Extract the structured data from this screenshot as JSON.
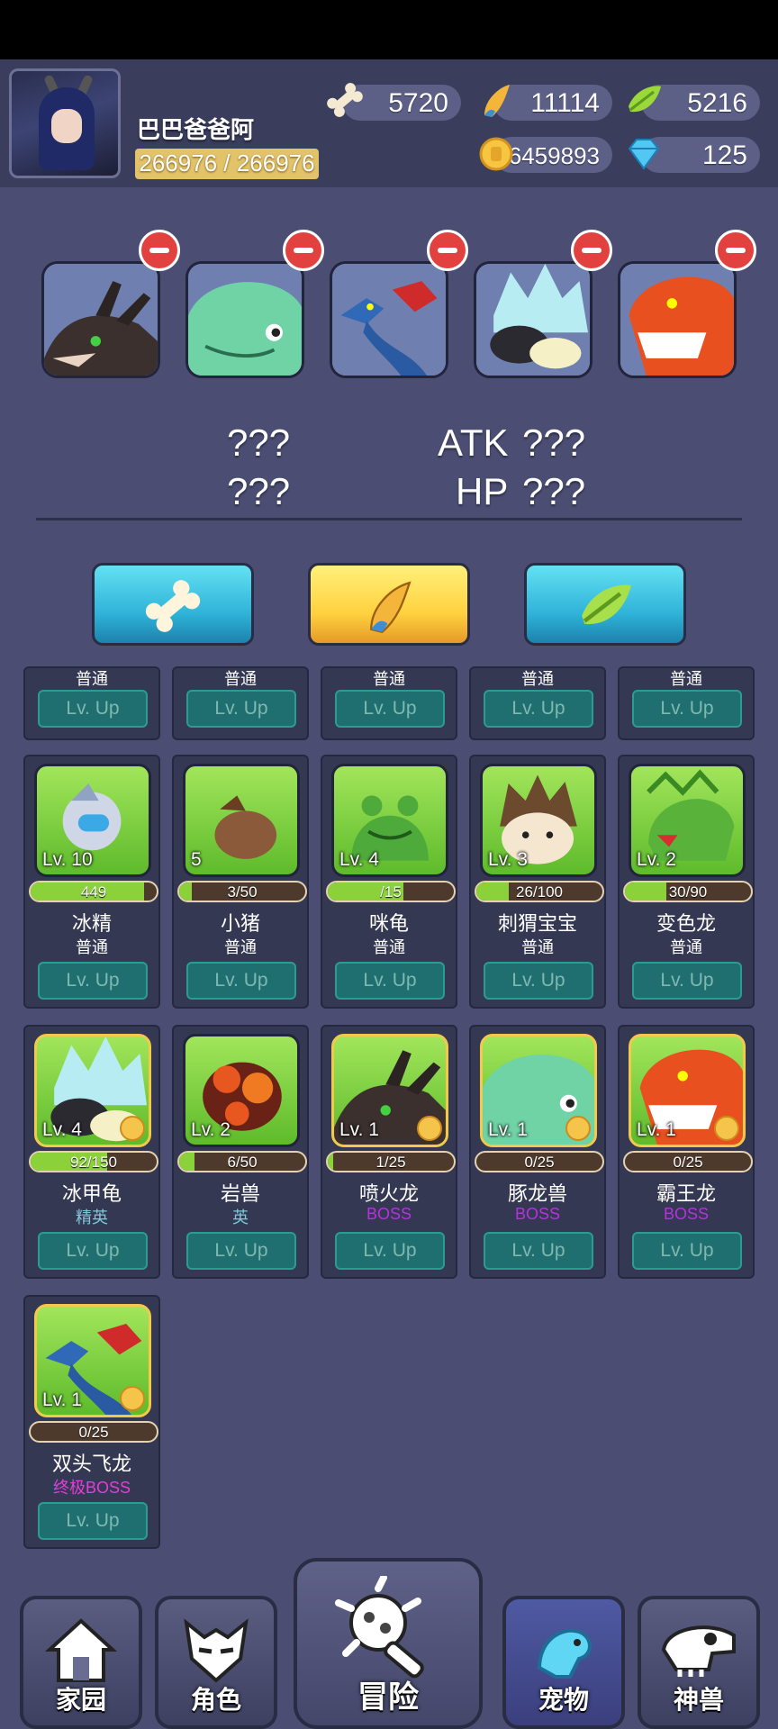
{
  "player": {
    "name": "巴巴爸爸阿",
    "hp_text": "266976 / 266976"
  },
  "resources": {
    "bone": "5720",
    "horn": "11114",
    "leaf": "5216",
    "coin": "6459893",
    "gem": "125"
  },
  "team_stats": {
    "left_top": "???",
    "left_bottom": "???",
    "atk_label": "ATK",
    "atk_value": "???",
    "hp_label": "HP",
    "hp_value": "???"
  },
  "partial_row": {
    "rarity": "普通",
    "button": "Lv. Up"
  },
  "pets": [
    {
      "name": "冰精",
      "level": "Lv. 10",
      "exp": "449",
      "exp_fill": 0.9,
      "rarity": "普通",
      "rarity_color": "#ffffff",
      "button": "Lv. Up"
    },
    {
      "name": "小猪",
      "level": "5",
      "exp": "3/50",
      "exp_fill": 0.1,
      "rarity": "普通",
      "rarity_color": "#ffffff",
      "button": "Lv. Up"
    },
    {
      "name": "咪龟",
      "level": "Lv. 4",
      "exp": "/15",
      "exp_fill": 0.6,
      "rarity": "普通",
      "rarity_color": "#ffffff",
      "button": "Lv. Up"
    },
    {
      "name": "刺猬宝宝",
      "level": "Lv. 3",
      "exp": "26/100",
      "exp_fill": 0.26,
      "rarity": "普通",
      "rarity_color": "#ffffff",
      "button": "Lv. Up"
    },
    {
      "name": "变色龙",
      "level": "Lv. 2",
      "exp": "30/90",
      "exp_fill": 0.33,
      "rarity": "普通",
      "rarity_color": "#ffffff",
      "button": "Lv. Up"
    },
    {
      "name": "冰甲龟",
      "level": "Lv. 4",
      "exp": "92/150",
      "exp_fill": 0.61,
      "rarity": "精英",
      "rarity_color": "#7fc8d8",
      "button": "Lv. Up"
    },
    {
      "name": "岩兽",
      "level": "Lv. 2",
      "exp": "6/50",
      "exp_fill": 0.12,
      "rarity": "英",
      "rarity_color": "#7fc8d8",
      "button": "Lv. Up"
    },
    {
      "name": "喷火龙",
      "level": "Lv. 1",
      "exp": "1/25",
      "exp_fill": 0.04,
      "rarity": "BOSS",
      "rarity_color": "#b532e0",
      "button": "Lv. Up"
    },
    {
      "name": "豚龙兽",
      "level": "Lv. 1",
      "exp": "0/25",
      "exp_fill": 0,
      "rarity": "BOSS",
      "rarity_color": "#b532e0",
      "button": "Lv. Up"
    },
    {
      "name": "霸王龙",
      "level": "Lv. 1",
      "exp": "0/25",
      "exp_fill": 0,
      "rarity": "BOSS",
      "rarity_color": "#b532e0",
      "button": "Lv. Up"
    },
    {
      "name": "双头飞龙",
      "level": "Lv. 1",
      "exp": "0/25",
      "exp_fill": 0,
      "rarity": "终极BOSS",
      "rarity_color": "#e23fd8",
      "button": "Lv. Up"
    }
  ],
  "nav": {
    "home": "家园",
    "character": "角色",
    "adventure": "冒险",
    "pets": "宠物",
    "beasts": "神兽"
  }
}
